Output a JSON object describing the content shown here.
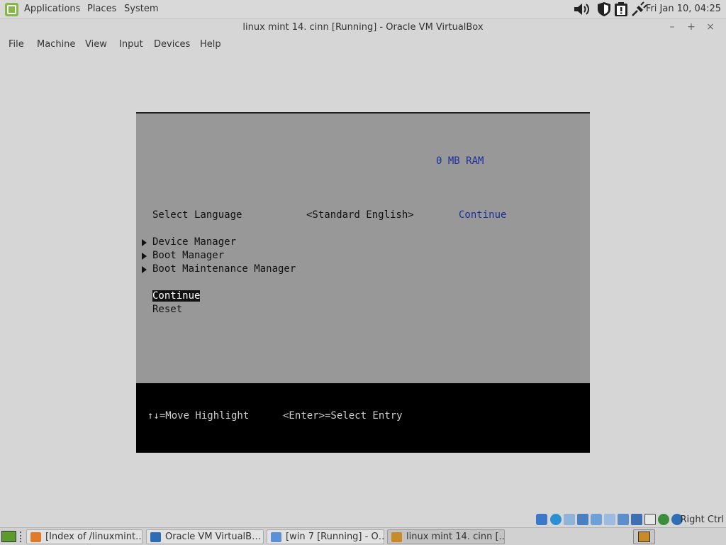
{
  "top_panel": {
    "menu": [
      "Applications",
      "Places",
      "System"
    ],
    "clock": "Fri Jan 10, 04:25"
  },
  "window": {
    "title": "linux mint 14. cinn [Running] - Oracle VM VirtualBox",
    "controls": [
      "–",
      "+",
      "×"
    ]
  },
  "menubar": [
    "File",
    "Machine",
    "View",
    "Input",
    "Devices",
    "Help"
  ],
  "vm": {
    "ram": "0 MB RAM",
    "language_label": "Select Language",
    "language_value": "<Standard English>",
    "language_continue": "Continue",
    "menu_items": [
      "Device Manager",
      "Boot Manager",
      "Boot Maintenance Manager"
    ],
    "actions": [
      "Continue",
      "Reset"
    ],
    "footer_move": "↑↓=Move Highlight",
    "footer_select": "<Enter>=Select Entry"
  },
  "status_bar": {
    "host_key": "Right Ctrl"
  },
  "taskbar": {
    "buttons": [
      "[Index of /linuxmint…",
      "Oracle VM VirtualB…",
      "[win 7 [Running] - O…",
      "linux mint 14. cinn [..."
    ]
  },
  "colors": {
    "vm_background": "#989898",
    "vm_highlight_text": "#1d2f9c",
    "mint_green": "#86b847"
  }
}
